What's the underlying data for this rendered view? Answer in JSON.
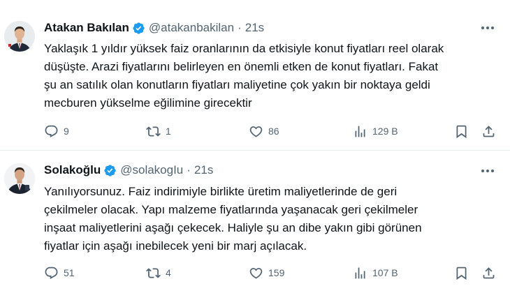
{
  "tweets": [
    {
      "author_name": "Atakan Bakılan",
      "handle": "@atakanbakilan",
      "separator": "·",
      "time": "21s",
      "text_lines": [
        "Yaklaşık 1 yıldır yüksek faiz oranlarının da etkisiyle konut fiyatları reel olarak",
        "düşüşte. Arazi fiyatlarını belirleyen en önemli etken de konut fiyatları. Fakat",
        "şu an satılık olan konutların fiyatları maliyetine çok yakın bir noktaya geldi",
        "mecburen yükselme eğilimine girecektir"
      ],
      "replies": "9",
      "reposts": "1",
      "likes": "86",
      "views": "129 B"
    },
    {
      "author_name": "Solakoğlu",
      "handle": "@solakogIu",
      "separator": "·",
      "time": "21s",
      "text_lines": [
        "Yanılıyorsunuz. Faiz indirimiyle birlikte üretim maliyetlerinde de geri",
        "çekilmeler olacak. Yapı malzeme fiyatlarında yaşanacak geri çekilmeler",
        "inşaat maliyetlerini aşağı çekecek. Haliyle şu an dibe yakın gibi görünen",
        "fiyatlar için aşağı inebilecek yeni bir marj açılacak."
      ],
      "replies": "51",
      "reposts": "4",
      "likes": "159",
      "views": "107 B"
    }
  ],
  "icons": {
    "verified": "verified-badge-icon",
    "more": "more-options-icon",
    "reply": "reply-icon",
    "repost": "repost-icon",
    "like": "like-icon",
    "views": "views-icon",
    "bookmark": "bookmark-icon",
    "share": "share-icon"
  },
  "colors": {
    "verified_blue": "#1d9bf0",
    "secondary_text": "#536471",
    "primary_text": "#0f1419"
  }
}
